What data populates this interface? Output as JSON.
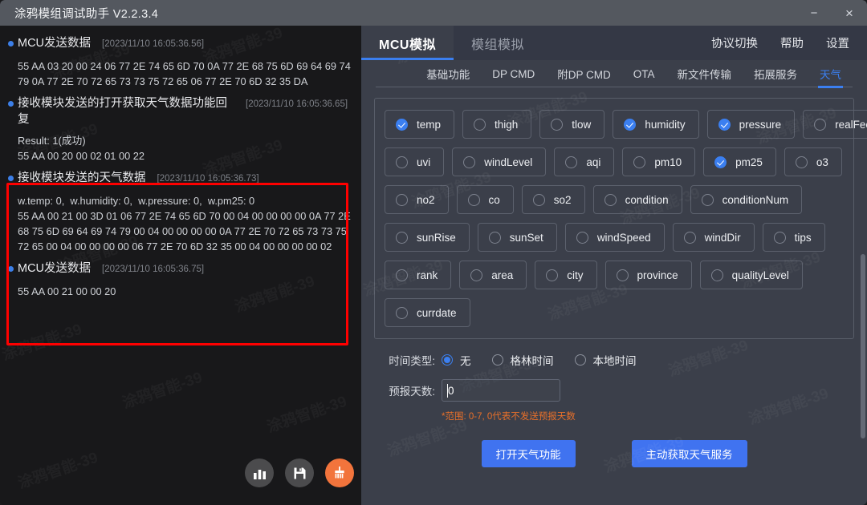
{
  "window": {
    "title": "涂鸦模组调试助手 V2.2.3.4",
    "minimize_label": "−",
    "close_label": "×",
    "accent_blue": "#3b7ff0",
    "accent_orange": "#f2743c",
    "highlight_red": "#fe0000",
    "watermark_text": "涂鸦智能-39"
  },
  "log": {
    "entries": [
      {
        "title": "MCU发送数据",
        "time": "[2023/11/10 16:05:36.56]",
        "lines": [
          "55 AA 03 20 00 24 06 77 2E 74 65 6D 70 0A 77 2E 68 75 6D 69 64 69 74 79 0A 77 2E 70 72 65 73 73 75 72 65 06 77 2E 70 6D 32 35 DA"
        ],
        "highlighted": false
      },
      {
        "title": "接收模块发送的打开获取天气数据功能回复",
        "time": "[2023/11/10 16:05:36.65]",
        "lines": [
          "Result: 1(成功)",
          "55 AA 00 20 00 02 01 00 22"
        ],
        "highlighted": false
      },
      {
        "title": "接收模块发送的天气数据",
        "time": "[2023/11/10 16:05:36.73]",
        "lines": [
          "w.temp: 0,  w.humidity: 0,  w.pressure: 0,  w.pm25: 0",
          "55 AA 00 21 00 3D 01 06 77 2E 74 65 6D 70 00 04 00 00 00 00 0A 77 2E 68 75 6D 69 64 69 74 79 00 04 00 00 00 00 0A 77 2E 70 72 65 73 73 75 72 65 00 04 00 00 00 00 06 77 2E 70 6D 32 35 00 04 00 00 00 00 02"
        ],
        "highlighted": true
      },
      {
        "title": "MCU发送数据",
        "time": "[2023/11/10 16:05:36.75]",
        "lines": [
          "55 AA 00 21 00 00 20"
        ],
        "highlighted": true
      }
    ],
    "fabs": [
      {
        "name": "bar-chart-icon",
        "label": "统计"
      },
      {
        "name": "save-icon",
        "label": "保存"
      },
      {
        "name": "broom-clear-icon",
        "label": "清空"
      }
    ]
  },
  "right": {
    "main_tabs": [
      {
        "label": "MCU模拟",
        "active": true
      },
      {
        "label": "模组模拟",
        "active": false
      }
    ],
    "tools": [
      {
        "label": "协议切换"
      },
      {
        "label": "帮助"
      },
      {
        "label": "设置"
      }
    ],
    "sub_tabs": [
      {
        "label": "基础功能",
        "active": false
      },
      {
        "label": "DP CMD",
        "active": false
      },
      {
        "label": "附DP CMD",
        "active": false
      },
      {
        "label": "OTA",
        "active": false
      },
      {
        "label": "新文件传输",
        "active": false
      },
      {
        "label": "拓展服务",
        "active": false
      },
      {
        "label": "天气",
        "active": true
      }
    ],
    "checkbox_rows": [
      [
        {
          "label": "temp",
          "checked": true
        },
        {
          "label": "thigh",
          "checked": false
        },
        {
          "label": "tlow",
          "checked": false
        },
        {
          "label": "humidity",
          "checked": true
        },
        {
          "label": "pressure",
          "checked": true
        },
        {
          "label": "realFeel",
          "checked": false
        }
      ],
      [
        {
          "label": "uvi",
          "checked": false
        },
        {
          "label": "windLevel",
          "checked": false
        },
        {
          "label": "aqi",
          "checked": false
        },
        {
          "label": "pm10",
          "checked": false
        },
        {
          "label": "pm25",
          "checked": true
        },
        {
          "label": "o3",
          "checked": false
        }
      ],
      [
        {
          "label": "no2",
          "checked": false
        },
        {
          "label": "co",
          "checked": false
        },
        {
          "label": "so2",
          "checked": false
        },
        {
          "label": "condition",
          "checked": false
        },
        {
          "label": "conditionNum",
          "checked": false
        }
      ],
      [
        {
          "label": "sunRise",
          "checked": false
        },
        {
          "label": "sunSet",
          "checked": false
        },
        {
          "label": "windSpeed",
          "checked": false
        },
        {
          "label": "windDir",
          "checked": false
        },
        {
          "label": "tips",
          "checked": false
        }
      ],
      [
        {
          "label": "rank",
          "checked": false
        },
        {
          "label": "area",
          "checked": false
        },
        {
          "label": "city",
          "checked": false
        },
        {
          "label": "province",
          "checked": false
        },
        {
          "label": "qualityLevel",
          "checked": false
        }
      ],
      [
        {
          "label": "currdate",
          "checked": false
        }
      ]
    ],
    "time_type": {
      "label": "时间类型:",
      "options": [
        {
          "label": "无",
          "selected": true
        },
        {
          "label": "格林时间",
          "selected": false
        },
        {
          "label": "本地时间",
          "selected": false
        }
      ]
    },
    "forecast": {
      "label": "预报天数:",
      "value": "0",
      "placeholder": "",
      "hint": "*范围: 0-7, 0代表不发送预报天数"
    },
    "buttons": [
      {
        "label": "打开天气功能"
      },
      {
        "label": "主动获取天气服务"
      }
    ]
  }
}
